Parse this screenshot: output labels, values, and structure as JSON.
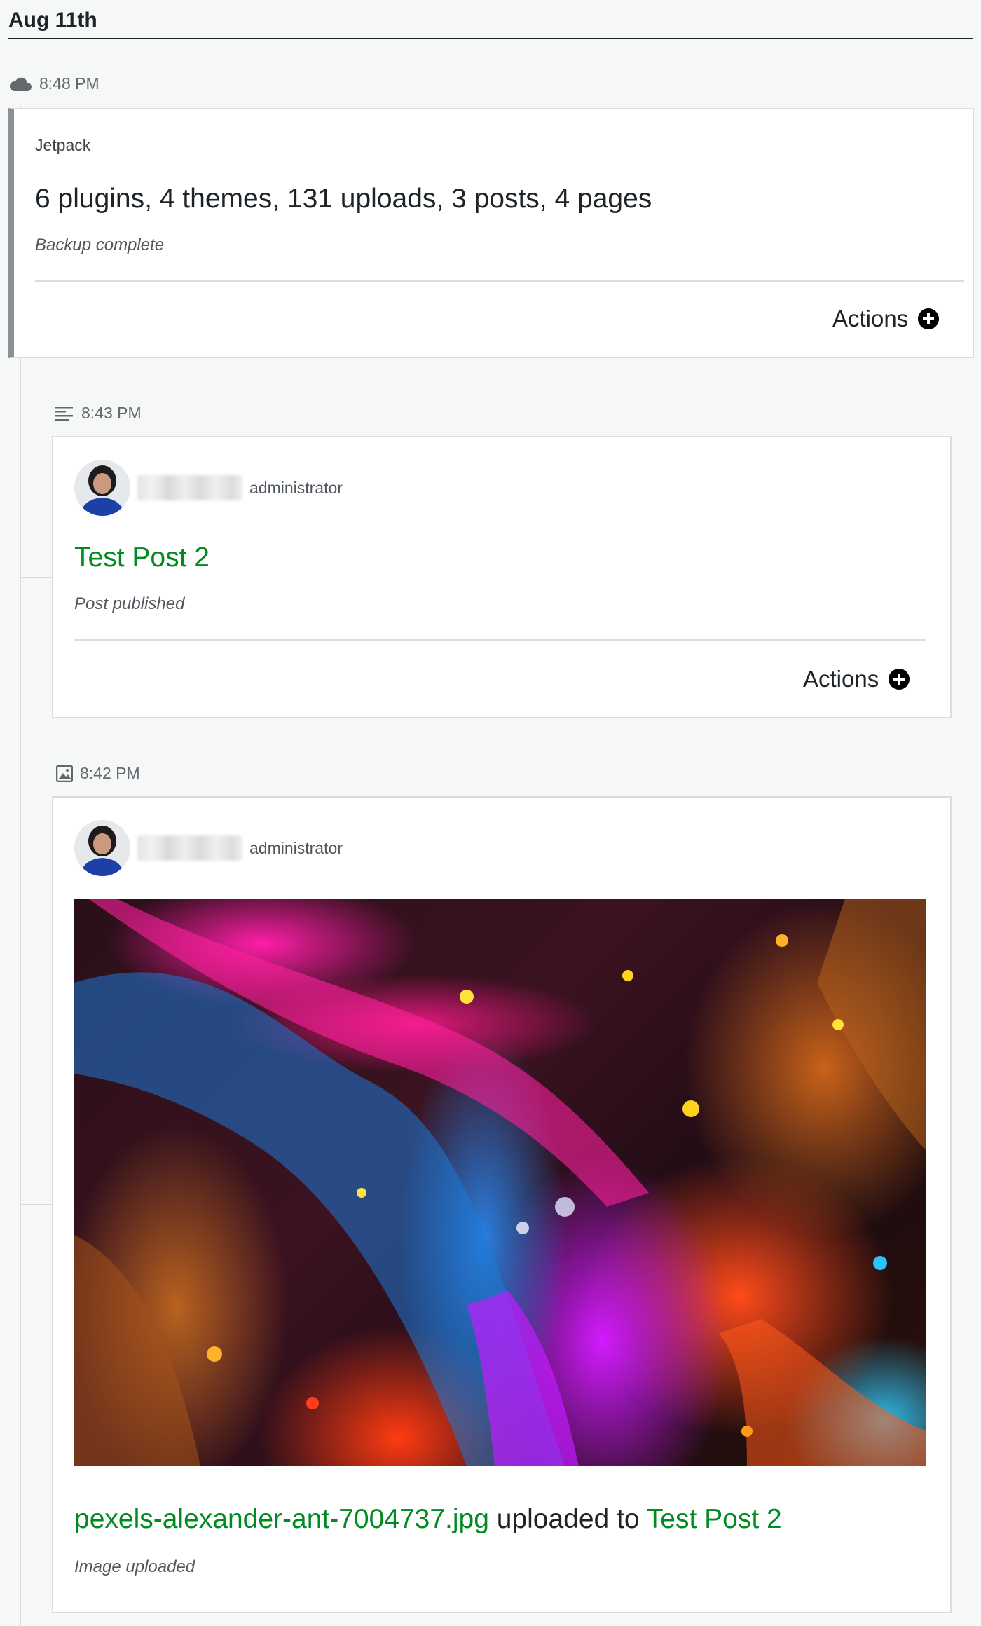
{
  "date_heading": "Aug 11th",
  "colors": {
    "link_green": "#008a20",
    "text_dark": "#1d2327",
    "muted": "#646970",
    "border": "#dcdcde",
    "accent_bar": "#8c8f94"
  },
  "events": [
    {
      "icon": "cloud-icon",
      "time": "8:48 PM",
      "source": "Jetpack",
      "headline": "6 plugins, 4 themes, 131 uploads, 3 posts, 4 pages",
      "status": "Backup complete",
      "actions_label": "Actions"
    },
    {
      "icon": "post-icon",
      "time": "8:43 PM",
      "role": "administrator",
      "title": "Test Post 2",
      "status": "Post published",
      "actions_label": "Actions"
    },
    {
      "icon": "image-icon",
      "time": "8:42 PM",
      "role": "administrator",
      "filename": "pexels-alexander-ant-7004737.jpg",
      "uploaded_to_text": " uploaded to ",
      "target_post": "Test Post 2",
      "status": "Image uploaded"
    }
  ]
}
